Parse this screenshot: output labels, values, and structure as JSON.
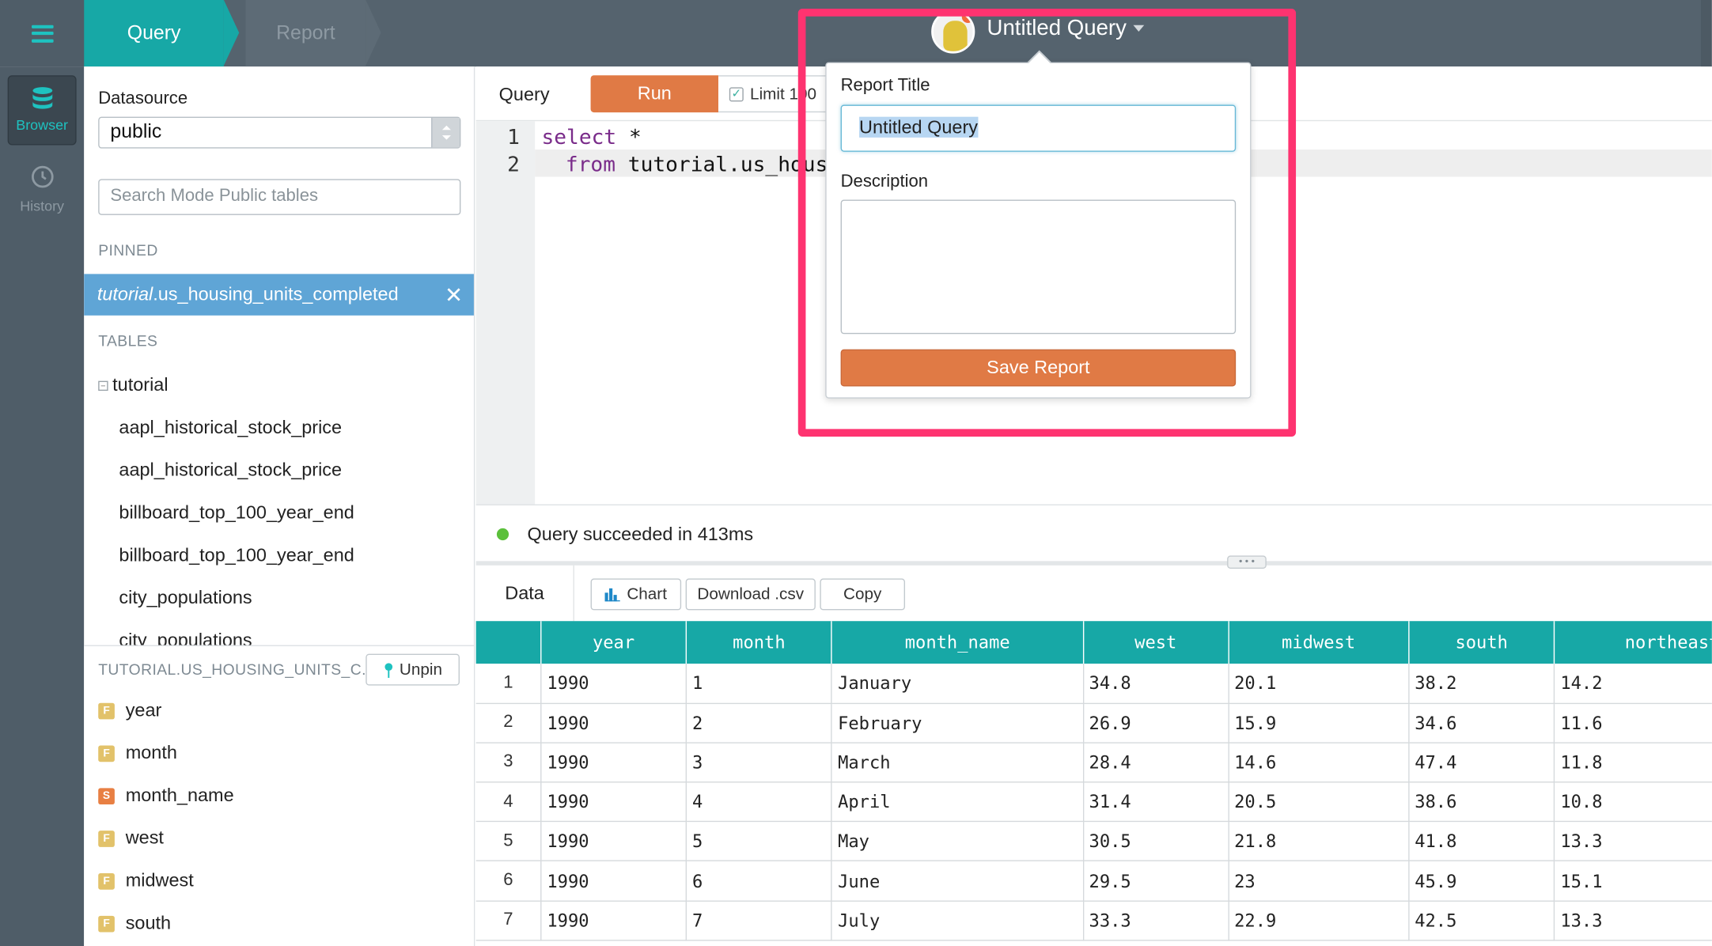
{
  "header": {
    "tabs": [
      {
        "label": "Query"
      },
      {
        "label": "Report"
      }
    ],
    "query_title": "Untitled Query"
  },
  "rail": {
    "items": [
      {
        "label": "Browser"
      },
      {
        "label": "History"
      }
    ]
  },
  "browser": {
    "datasource_label": "Datasource",
    "datasource_value": "public",
    "search_placeholder": "Search Mode Public tables",
    "pinned_heading": "PINNED",
    "pinned_schema": "tutorial",
    "pinned_table": ".us_housing_units_completed",
    "tables_heading": "TABLES",
    "schema_name": "tutorial",
    "tables": [
      "aapl_historical_stock_price",
      "aapl_historical_stock_price",
      "billboard_top_100_year_end",
      "billboard_top_100_year_end",
      "city_populations",
      "city_populations"
    ],
    "detail_heading": "TUTORIAL.US_HOUSING_UNITS_C...",
    "unpin_label": "Unpin",
    "fields": [
      {
        "type": "F",
        "name": "year"
      },
      {
        "type": "F",
        "name": "month"
      },
      {
        "type": "S",
        "name": "month_name"
      },
      {
        "type": "F",
        "name": "west"
      },
      {
        "type": "F",
        "name": "midwest"
      },
      {
        "type": "F",
        "name": "south"
      }
    ]
  },
  "editor": {
    "tab_label": "Query",
    "run_label": "Run",
    "limit_label": "Limit 100",
    "lines": [
      {
        "num": "1",
        "kw": "select",
        "rest": " *"
      },
      {
        "num": "2",
        "kw": "from",
        "rest": " tutorial.us_housing_units_completed"
      }
    ]
  },
  "status": {
    "text": "Query succeeded in 413ms"
  },
  "results": {
    "tab_label": "Data",
    "buttons": {
      "chart": "Chart",
      "download": "Download .csv",
      "copy": "Copy"
    },
    "columns": [
      "year",
      "month",
      "month_name",
      "west",
      "midwest",
      "south",
      "northeast"
    ],
    "rows": [
      [
        "1",
        "1990",
        "1",
        "January",
        "34.8",
        "20.1",
        "38.2",
        "14.2"
      ],
      [
        "2",
        "1990",
        "2",
        "February",
        "26.9",
        "15.9",
        "34.6",
        "11.6"
      ],
      [
        "3",
        "1990",
        "3",
        "March",
        "28.4",
        "14.6",
        "47.4",
        "11.8"
      ],
      [
        "4",
        "1990",
        "4",
        "April",
        "31.4",
        "20.5",
        "38.6",
        "10.8"
      ],
      [
        "5",
        "1990",
        "5",
        "May",
        "30.5",
        "21.8",
        "41.8",
        "13.3"
      ],
      [
        "6",
        "1990",
        "6",
        "June",
        "29.5",
        "23",
        "45.9",
        "15.1"
      ],
      [
        "7",
        "1990",
        "7",
        "July",
        "33.3",
        "22.9",
        "42.5",
        "13.3"
      ]
    ]
  },
  "popover": {
    "title_label": "Report Title",
    "title_value": "Untitled Query",
    "description_label": "Description",
    "description_value": "",
    "save_label": "Save Report"
  },
  "colors": {
    "topbar": "#55636e",
    "teal": "#17a8a6",
    "run_orange": "#e07a45",
    "pinned_blue": "#5fa5d6",
    "highlight_pink": "#fe3370"
  }
}
